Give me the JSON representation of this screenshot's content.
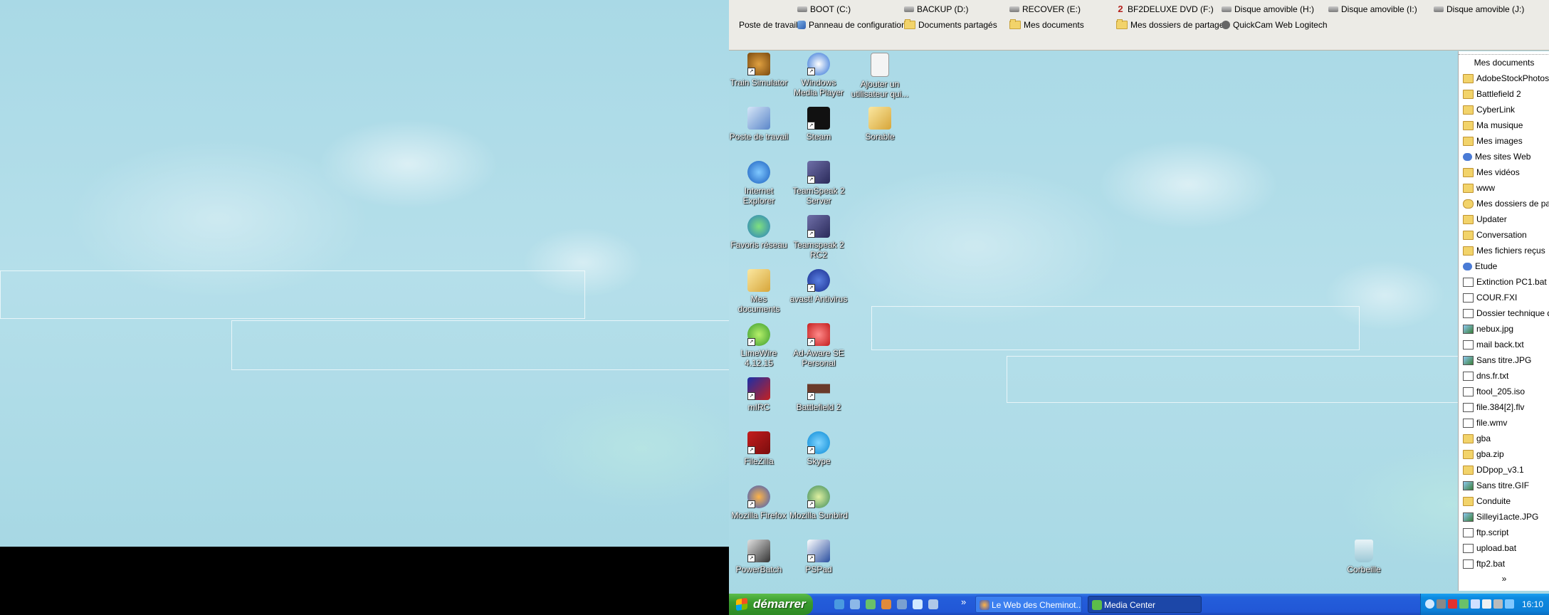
{
  "topbar": {
    "row1": [
      {
        "label": "BOOT (C:)",
        "icon": "drive-icon"
      },
      {
        "label": "BACKUP (D:)",
        "icon": "drive-icon"
      },
      {
        "label": "RECOVER (E:)",
        "icon": "drive-icon"
      },
      {
        "label": "BF2DELUXE DVD (F:)",
        "icon": "dvd-icon"
      },
      {
        "label": "Disque amovible (H:)",
        "icon": "drive-icon"
      },
      {
        "label": "Disque amovible (I:)",
        "icon": "drive-icon"
      },
      {
        "label": "Disque amovible (J:)",
        "icon": "drive-icon"
      }
    ],
    "row2": [
      {
        "label": "Poste de travail"
      },
      {
        "label": "Panneau de configuration",
        "icon": "control-panel-icon"
      },
      {
        "label": "Documents partagés",
        "icon": "folder-icon"
      },
      {
        "label": "Mes documents",
        "icon": "folder-icon"
      },
      {
        "label": "Mes dossiers de partage",
        "icon": "share-icon"
      },
      {
        "label": "QuickCam Web Logitech",
        "icon": "webcam-icon"
      }
    ]
  },
  "desktop": {
    "col1": [
      "Train Simulator",
      "Poste de travail",
      "Internet Explorer",
      "Favoris réseau",
      "Mes documents",
      "LimeWire 4.12.15",
      "mIRC",
      "FileZilla",
      "Mozilla Firefox",
      "PowerBatch"
    ],
    "col2": [
      "Windows Media Player",
      "Steam",
      "TeamSpeak 2 Server",
      "Teamspeak 2 RC2",
      "avast! Antivirus",
      "Ad-Aware SE Personal",
      "Battlefield 2",
      "Skype",
      "Mozilla Sunbird",
      "PSPad"
    ],
    "col3": [
      "Ajouter un utilisateur qui...",
      "Sorable"
    ],
    "recycle": "Corbeille"
  },
  "rpanel": {
    "title": "Mes documents",
    "items": [
      {
        "label": "AdobeStockPhotos",
        "type": "folder"
      },
      {
        "label": "Battlefield 2",
        "type": "folder"
      },
      {
        "label": "CyberLink",
        "type": "folder"
      },
      {
        "label": "Ma musique",
        "type": "folder"
      },
      {
        "label": "Mes images",
        "type": "folder"
      },
      {
        "label": "Mes sites Web",
        "type": "web"
      },
      {
        "label": "Mes vidéos",
        "type": "folder"
      },
      {
        "label": "www",
        "type": "folder"
      },
      {
        "label": "Mes dossiers de partage",
        "type": "share"
      },
      {
        "label": "Updater",
        "type": "folder"
      },
      {
        "label": "Conversation",
        "type": "folder"
      },
      {
        "label": "Mes fichiers reçus",
        "type": "folder"
      },
      {
        "label": "Etude",
        "type": "web"
      },
      {
        "label": "Extinction PC1.bat",
        "type": "file"
      },
      {
        "label": "COUR.FXI",
        "type": "file"
      },
      {
        "label": "Dossier technique de",
        "type": "file"
      },
      {
        "label": "nebux.jpg",
        "type": "img"
      },
      {
        "label": "mail back.txt",
        "type": "file"
      },
      {
        "label": "Sans titre.JPG",
        "type": "img"
      },
      {
        "label": "dns.fr.txt",
        "type": "file"
      },
      {
        "label": "ftool_205.iso",
        "type": "file"
      },
      {
        "label": "file.384[2].flv",
        "type": "file"
      },
      {
        "label": "file.wmv",
        "type": "file"
      },
      {
        "label": "gba",
        "type": "folder"
      },
      {
        "label": "gba.zip",
        "type": "folder"
      },
      {
        "label": "DDpop_v3.1",
        "type": "folder"
      },
      {
        "label": "Sans titre.GIF",
        "type": "img"
      },
      {
        "label": "Conduite",
        "type": "folder"
      },
      {
        "label": "Silleyi1acte.JPG",
        "type": "img"
      },
      {
        "label": "ftp.script",
        "type": "file"
      },
      {
        "label": "upload.bat",
        "type": "file"
      },
      {
        "label": "ftp2.bat",
        "type": "file"
      }
    ],
    "more": "»"
  },
  "taskbar": {
    "start_label": "démarrer",
    "quicklaunch_more": "»",
    "buttons": [
      {
        "label": "Le Web des Cheminot...",
        "active": false
      },
      {
        "label": "Media Center",
        "active": true
      }
    ],
    "clock": "16:10"
  },
  "colors": {
    "accent": "#245edb",
    "start_green": "#3a9b2e",
    "tray_blue": "#0c80d8"
  }
}
